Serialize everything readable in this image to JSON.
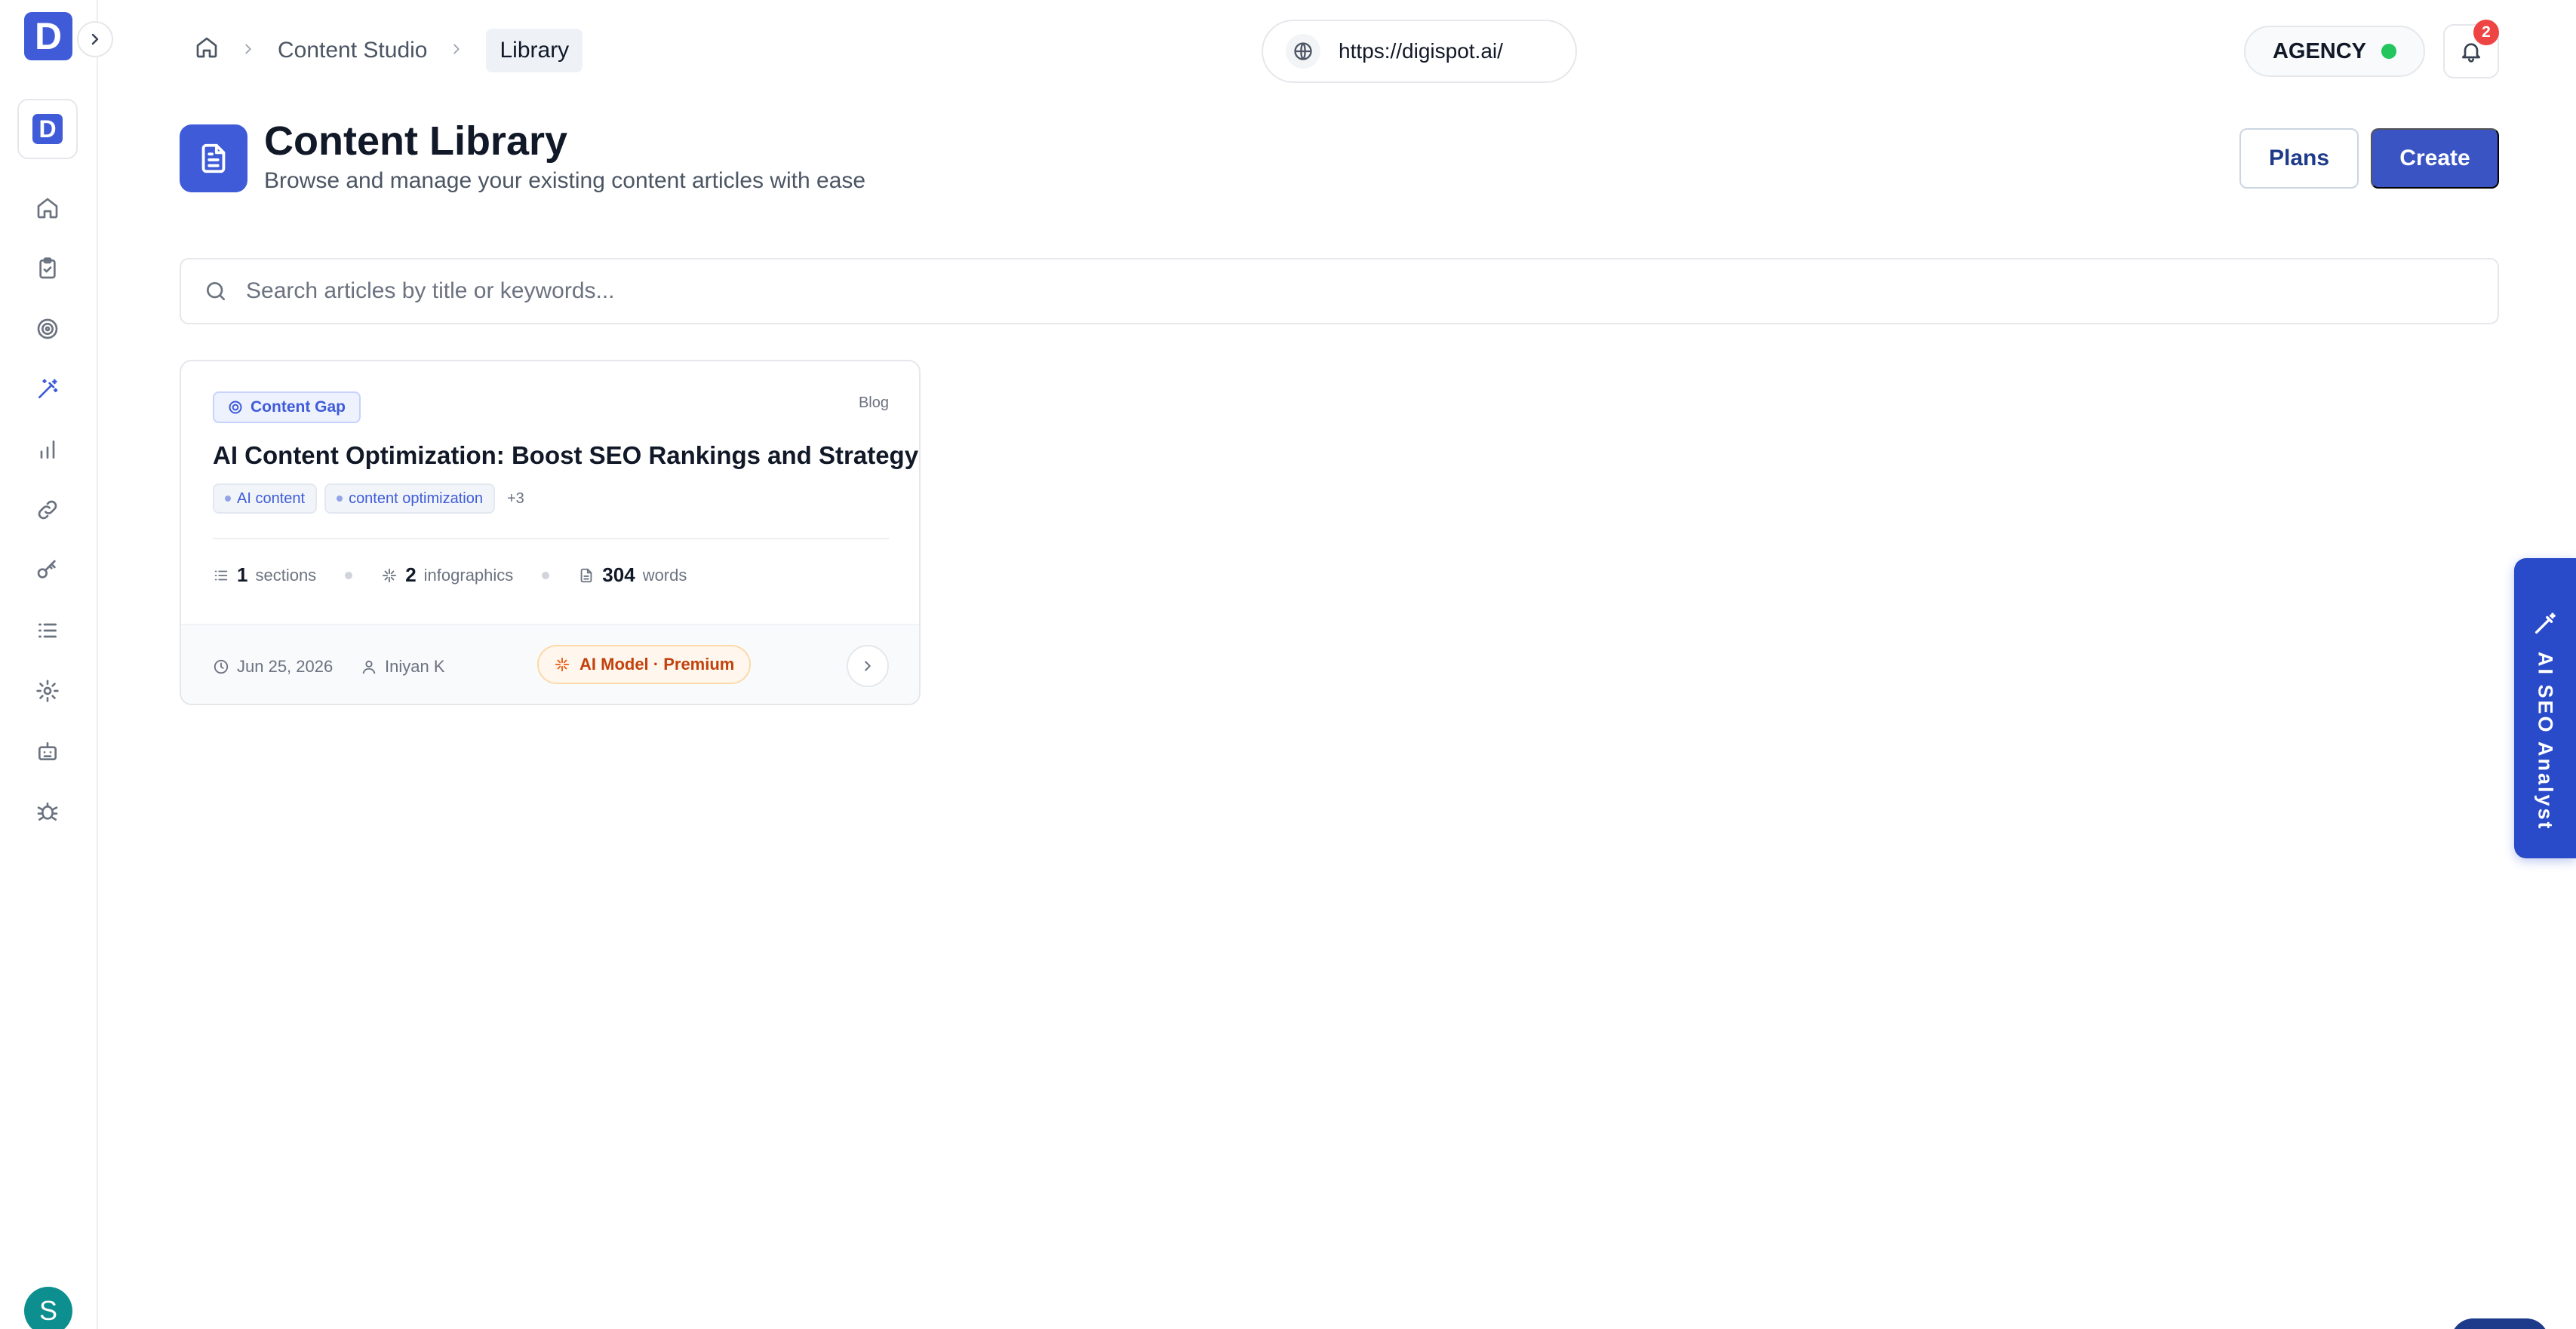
{
  "brand": {
    "letter": "D",
    "workspace_letter": "D"
  },
  "sidebar": {
    "items": [
      {
        "name": "home",
        "icon": "home-icon"
      },
      {
        "name": "tasks",
        "icon": "clipboard-check-icon"
      },
      {
        "name": "targets",
        "icon": "target-icon"
      },
      {
        "name": "content-studio",
        "icon": "wand-icon",
        "active": true
      },
      {
        "name": "analytics",
        "icon": "bar-chart-icon"
      },
      {
        "name": "links",
        "icon": "link-icon"
      },
      {
        "name": "keywords",
        "icon": "key-icon"
      },
      {
        "name": "lists",
        "icon": "list-icon"
      },
      {
        "name": "settings",
        "icon": "gear-icon"
      },
      {
        "name": "bots",
        "icon": "robot-icon"
      },
      {
        "name": "crawler",
        "icon": "bug-icon"
      }
    ],
    "user_initial": "S"
  },
  "breadcrumb": {
    "parent": "Content Studio",
    "current": "Library"
  },
  "site": {
    "url": "https://digispot.ai/"
  },
  "account": {
    "plan_label": "AGENCY",
    "status_color": "#22c55e",
    "notification_count": "2"
  },
  "header": {
    "title": "Content Library",
    "subtitle": "Browse and manage your existing content articles with ease",
    "plans_label": "Plans",
    "create_label": "Create"
  },
  "search": {
    "placeholder": "Search articles by title or keywords...",
    "value": ""
  },
  "articles": [
    {
      "category": "Content Gap",
      "type": "Blog",
      "title": "AI Content Optimization: Boost SEO Rankings and Strategy",
      "tags": [
        "AI content",
        "content optimization"
      ],
      "more_tags": "+3",
      "sections_count": "1",
      "sections_label": "sections",
      "infographics_count": "2",
      "infographics_label": "infographics",
      "words_count": "304",
      "words_label": "words",
      "date": "Jun 25, 2026",
      "author": "Iniyan K",
      "model": "AI Model · Premium"
    }
  ],
  "analyst_tab": {
    "label": "AI SEO Analyst"
  },
  "colors": {
    "accent": "#3f5bd8",
    "button_primary": "#3a55c3",
    "premium": "#c2410c"
  }
}
